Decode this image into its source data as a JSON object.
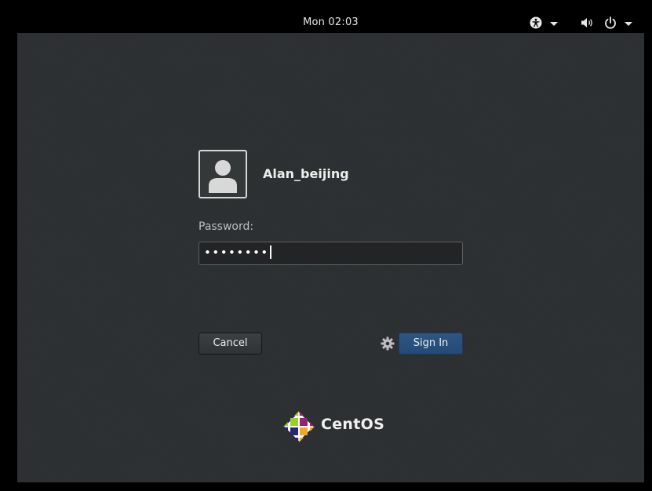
{
  "topbar": {
    "clock": "Mon 02:03",
    "icons": [
      "accessibility-icon",
      "chevron-down-icon",
      "volume-icon",
      "power-icon",
      "chevron-down-icon"
    ]
  },
  "user": {
    "name": "Alan_beijing",
    "avatar_icon": "user-avatar-icon"
  },
  "password": {
    "label": "Password:",
    "masked_value": "••••••••"
  },
  "buttons": {
    "cancel": "Cancel",
    "sign_in": "Sign In",
    "session_icon": "gear-icon"
  },
  "branding": {
    "logo_text": "CentOS",
    "logo_icon": "centos-logo-icon"
  },
  "colors": {
    "background": "#2d3032",
    "topbar": "#000000",
    "sign_in_button": "#2a5080",
    "text": "#eeeeec"
  }
}
